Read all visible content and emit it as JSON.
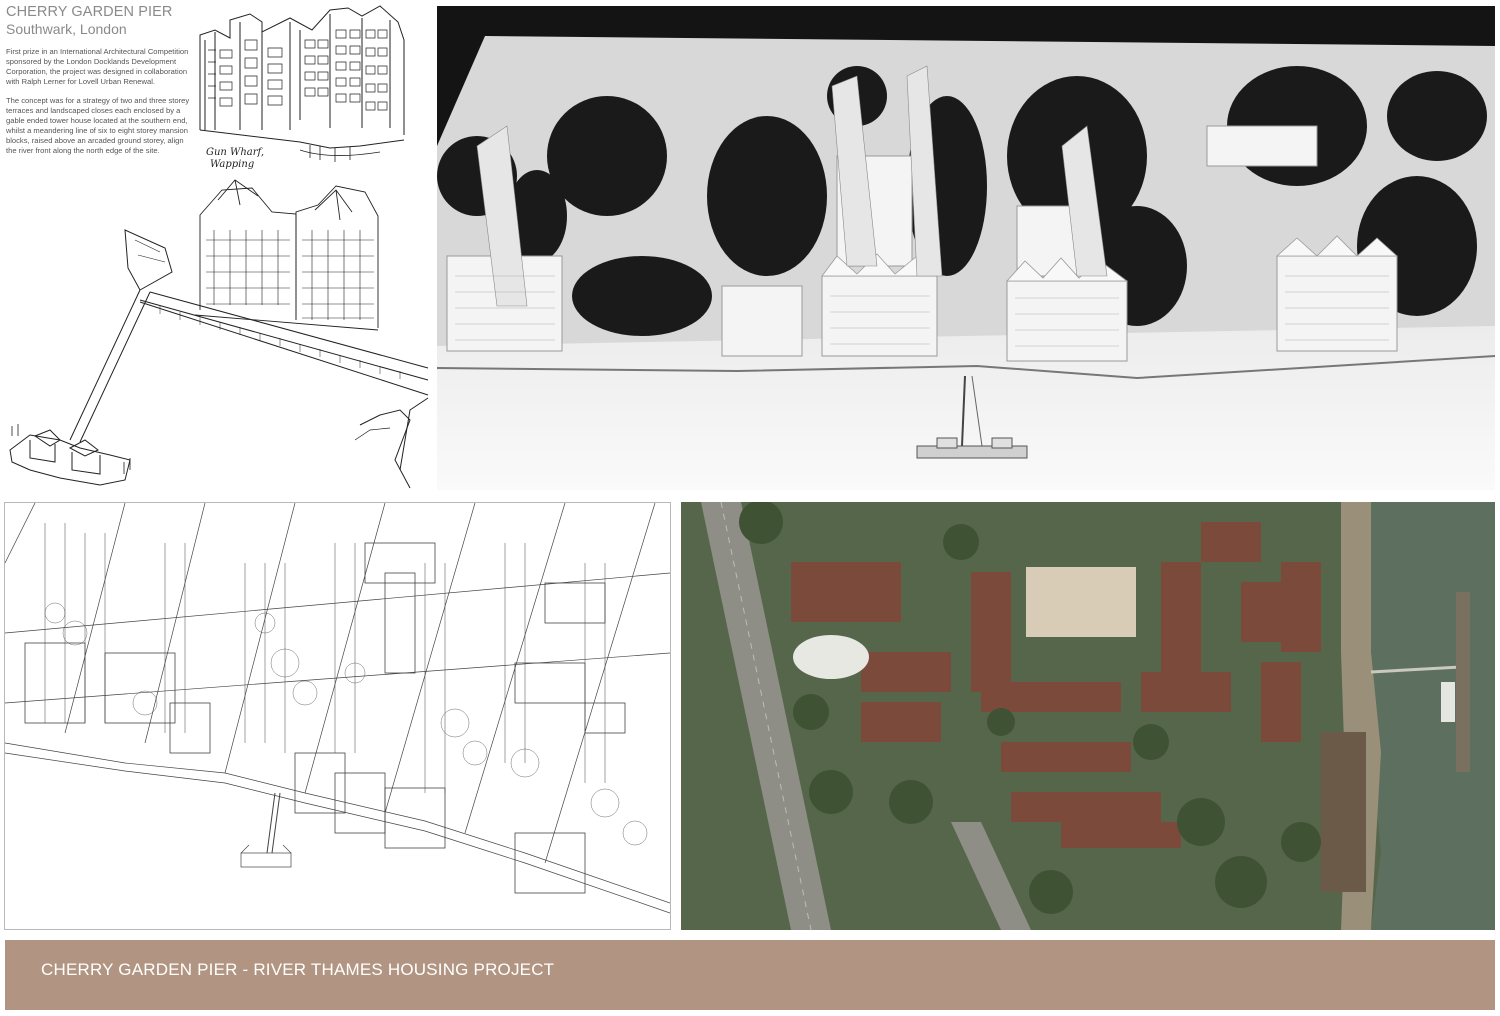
{
  "project": {
    "title": "CHERRY GARDEN PIER",
    "location": "Southwark, London",
    "paragraphs": [
      "First prize in an International Architectural Competition sponsored by the London Docklands Development Corporation, the project was designed in collaboration with Ralph Lerner for Lovell Urban Renewal.",
      "The concept was for a strategy of two and three storey terraces and landscaped closes each enclosed by a gable ended tower house located at the southern end, whilst a meandering line of six to eight storey mansion blocks, raised above an arcaded ground storey, align the river front along the north edge of the site."
    ]
  },
  "sketch": {
    "annotation_line1": "Gun Wharf,",
    "annotation_line2": "Wapping"
  },
  "banner": {
    "title": "CHERRY GARDEN PIER - RIVER THAMES HOUSING PROJECT"
  },
  "colors": {
    "banner_bg": "#b19582",
    "banner_text": "#ffffff",
    "title_text": "#8a8a8a",
    "water": "#5d6f5e",
    "model_bg": "#141414"
  }
}
